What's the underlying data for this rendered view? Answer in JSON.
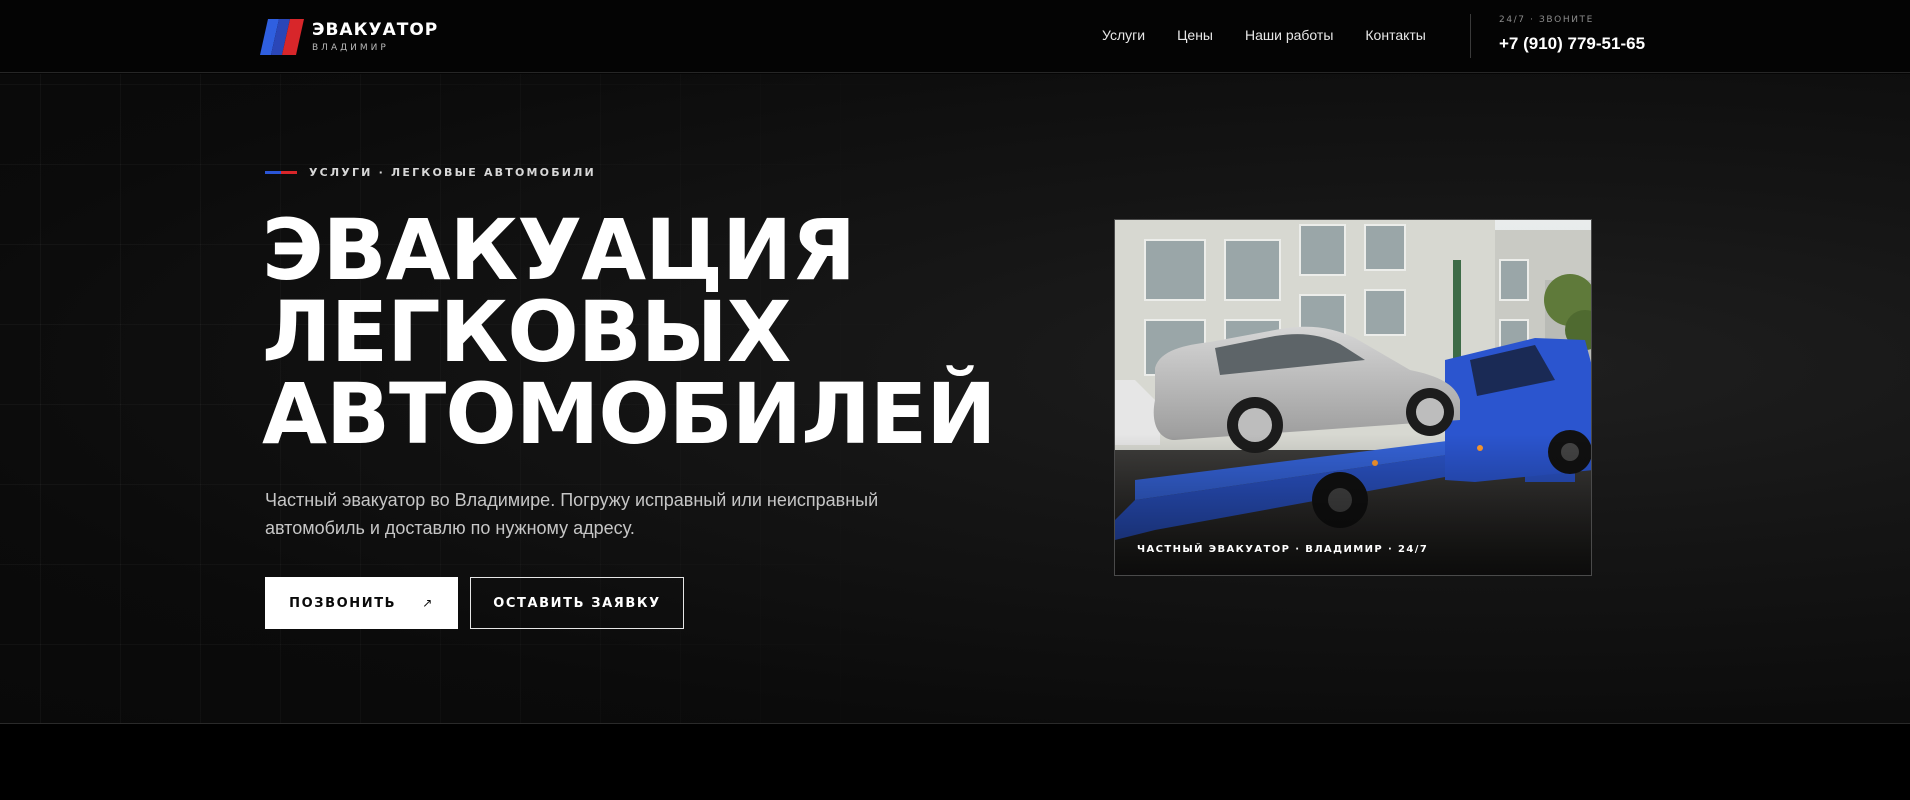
{
  "brand": {
    "title": "ЭВАКУАТОР",
    "subtitle": "ВЛАДИМИР",
    "logo_icon": "tricolor-stripes-logo"
  },
  "nav": {
    "items": [
      {
        "label": "Услуги"
      },
      {
        "label": "Цены"
      },
      {
        "label": "Наши работы"
      },
      {
        "label": "Контакты"
      }
    ]
  },
  "contact": {
    "label": "24/7 · ЗВОНИТЕ",
    "phone": "+7 (910) 779-51-65"
  },
  "hero": {
    "eyebrow": "УСЛУГИ · ЛЕГКОВЫЕ АВТОМОБИЛИ",
    "title_lines": [
      "ЭВАКУАЦИЯ",
      "ЛЕГКОВЫХ",
      "АВТОМОБИЛЕЙ"
    ],
    "description": "Частный эвакуатор во Владимире. Погружу исправный или неисправный автомобиль и доставлю по нужному адресу.",
    "primary_button": "ПОЗВОНИТЬ",
    "primary_button_arrow": "↗",
    "secondary_button": "ОСТАВИТЬ ЗАЯВКУ",
    "photo_caption": "ЧАСТНЫЙ ЭВАКУАТОР · ВЛАДИМИР · 24/7"
  },
  "colors": {
    "accent_blue": "#2a55d6",
    "accent_red": "#d8262a",
    "background": "#050505",
    "button_light": "#ffffff"
  }
}
